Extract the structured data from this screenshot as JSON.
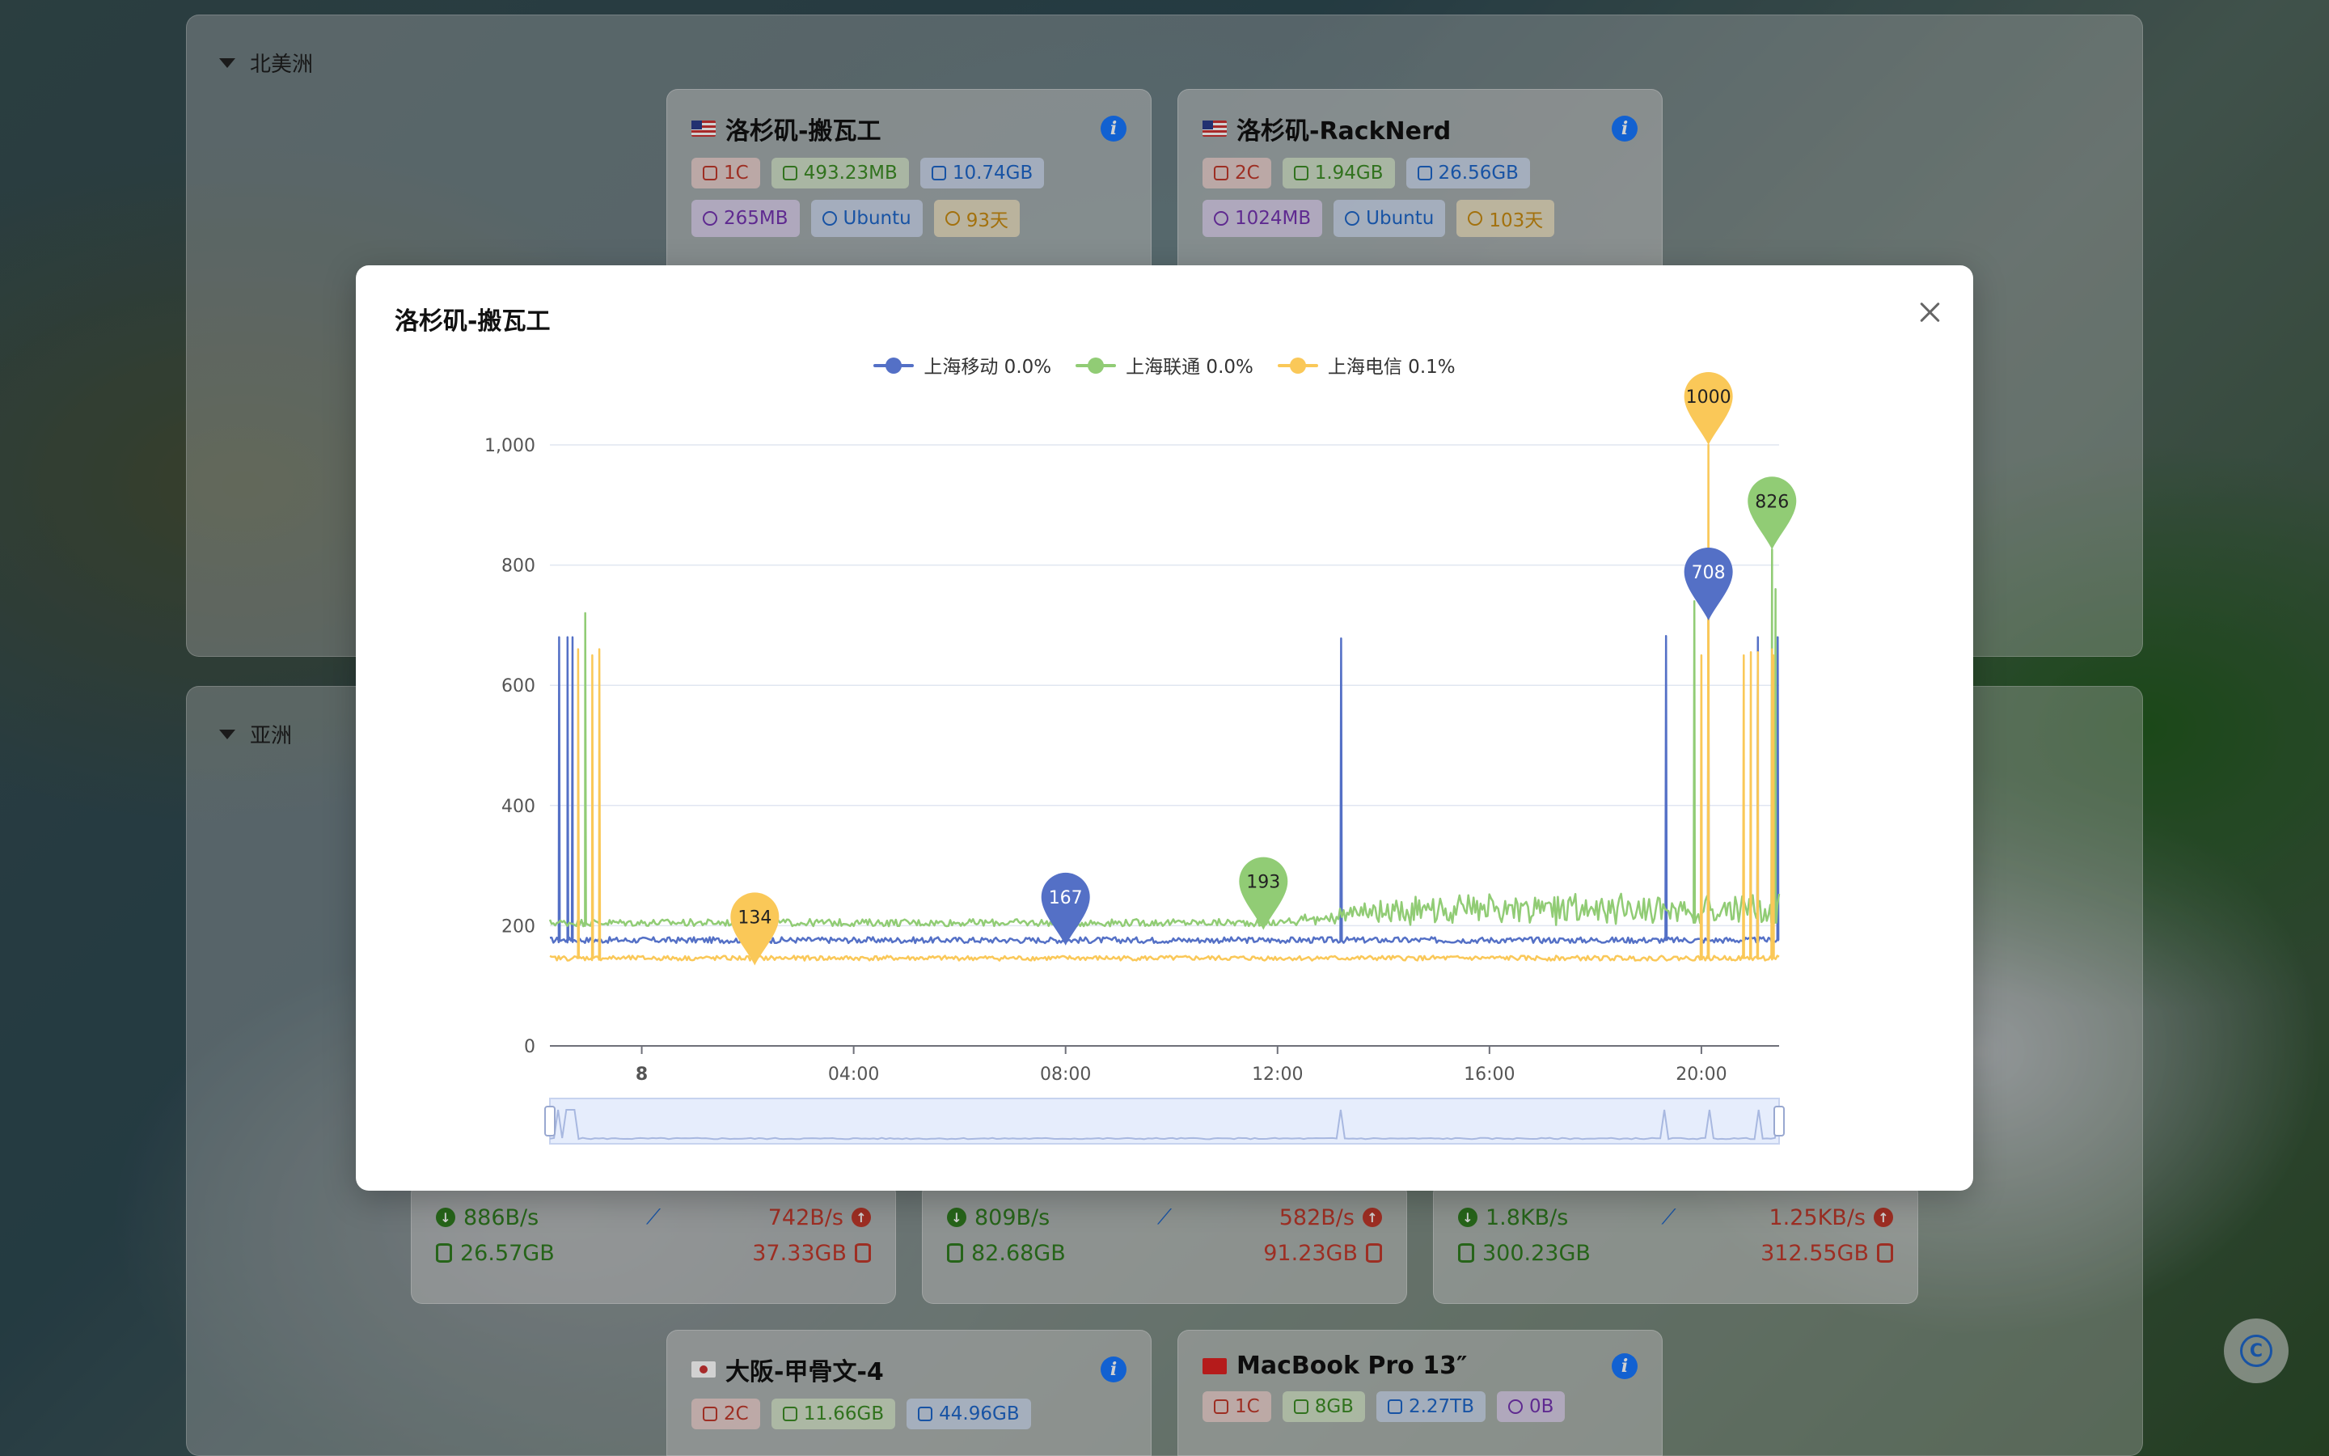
{
  "regions": [
    {
      "name": "北美洲"
    },
    {
      "name": "亚洲"
    }
  ],
  "cards": [
    {
      "title": "洛杉矶-搬瓦工",
      "flag": "us-flag-icon",
      "tags": [
        {
          "text": "1C",
          "color": "red",
          "icon": "cpu-icon"
        },
        {
          "text": "493.23MB",
          "color": "green",
          "icon": "memory-icon"
        },
        {
          "text": "10.74GB",
          "color": "blue",
          "icon": "disk-icon"
        },
        {
          "text": "265MB",
          "color": "purple",
          "icon": "swap-icon"
        },
        {
          "text": "Ubuntu",
          "color": "blue",
          "icon": "os-icon"
        },
        {
          "text": "93天",
          "color": "gold",
          "icon": "clock-icon"
        }
      ]
    },
    {
      "title": "洛杉矶-RackNerd",
      "flag": "us-flag-icon",
      "tags": [
        {
          "text": "2C",
          "color": "red",
          "icon": "cpu-icon"
        },
        {
          "text": "1.94GB",
          "color": "green",
          "icon": "memory-icon"
        },
        {
          "text": "26.56GB",
          "color": "blue",
          "icon": "disk-icon"
        },
        {
          "text": "1024MB",
          "color": "purple",
          "icon": "swap-icon"
        },
        {
          "text": "Ubuntu",
          "color": "blue",
          "icon": "os-icon"
        },
        {
          "text": "103天",
          "color": "gold",
          "icon": "clock-icon"
        }
      ]
    },
    {
      "title": "大阪-甲骨文-4",
      "flag": "jp-flag-icon",
      "tags": [
        {
          "text": "2C",
          "color": "red",
          "icon": "cpu-icon"
        },
        {
          "text": "11.66GB",
          "color": "green",
          "icon": "memory-icon"
        },
        {
          "text": "44.96GB",
          "color": "blue",
          "icon": "disk-icon"
        }
      ]
    },
    {
      "title": "MacBook Pro 13″",
      "flag": "cn-flag-icon",
      "tags": [
        {
          "text": "1C",
          "color": "red",
          "icon": "cpu-icon"
        },
        {
          "text": "8GB",
          "color": "green",
          "icon": "memory-icon"
        },
        {
          "text": "2.27TB",
          "color": "blue",
          "icon": "disk-icon"
        },
        {
          "text": "0B",
          "color": "purple",
          "icon": "swap-icon"
        }
      ]
    }
  ],
  "net_cards": [
    {
      "down_speed": "886B/s",
      "up_speed": "742B/s",
      "down_total": "26.57GB",
      "up_total": "37.33GB"
    },
    {
      "down_speed": "809B/s",
      "up_speed": "582B/s",
      "down_total": "82.68GB",
      "up_total": "91.23GB"
    },
    {
      "down_speed": "1.8KB/s",
      "up_speed": "1.25KB/s",
      "down_total": "300.23GB",
      "up_total": "312.55GB"
    }
  ],
  "modal": {
    "title": "洛杉矶-搬瓦工"
  },
  "legend": [
    {
      "label": "上海移动 0.0%",
      "color": "#5470c6"
    },
    {
      "label": "上海联通 0.0%",
      "color": "#91cc75"
    },
    {
      "label": "上海电信 0.1%",
      "color": "#fac858"
    }
  ],
  "chart_data": {
    "type": "line",
    "x_unit": "hour",
    "x_range": [
      6.2,
      23.6
    ],
    "ylim": [
      0,
      1000
    ],
    "y_ticks": [
      0,
      200,
      400,
      600,
      800,
      1000
    ],
    "y_tick_labels": [
      "0",
      "200",
      "400",
      "600",
      "800",
      "1,000"
    ],
    "x_ticks": [
      {
        "value": 7.5,
        "label": "8"
      },
      {
        "value": 10.5,
        "label": "04:00"
      },
      {
        "value": 13.5,
        "label": "08:00"
      },
      {
        "value": 16.5,
        "label": "12:00"
      },
      {
        "value": 19.5,
        "label": "16:00"
      },
      {
        "value": 22.5,
        "label": "20:00"
      }
    ],
    "grid": true,
    "legend_position": "top-center",
    "series": [
      {
        "name": "上海移动",
        "color": "#5470c6",
        "baseline": 176,
        "noise": 5,
        "spikes": [
          {
            "x": 6.33,
            "y": 680
          },
          {
            "x": 6.45,
            "y": 680
          },
          {
            "x": 6.52,
            "y": 680
          },
          {
            "x": 17.4,
            "y": 678
          },
          {
            "x": 22.0,
            "y": 682
          },
          {
            "x": 22.6,
            "y": 708
          },
          {
            "x": 23.3,
            "y": 680
          },
          {
            "x": 23.58,
            "y": 680
          }
        ],
        "markers": [
          {
            "x": 13.5,
            "y": 167,
            "label": "167"
          },
          {
            "x": 22.6,
            "y": 708,
            "label": "708"
          }
        ]
      },
      {
        "name": "上海联通",
        "color": "#91cc75",
        "baseline": 205,
        "noise": 6,
        "spikes": [
          {
            "x": 6.7,
            "y": 720
          },
          {
            "x": 22.4,
            "y": 740
          },
          {
            "x": 23.5,
            "y": 826
          },
          {
            "x": 23.55,
            "y": 760
          }
        ],
        "markers": [
          {
            "x": 16.3,
            "y": 193,
            "label": "193"
          },
          {
            "x": 23.5,
            "y": 826,
            "label": "826"
          }
        ]
      },
      {
        "name": "上海电信",
        "color": "#fac858",
        "baseline": 146,
        "noise": 4,
        "spikes": [
          {
            "x": 6.6,
            "y": 660
          },
          {
            "x": 6.8,
            "y": 650
          },
          {
            "x": 6.9,
            "y": 660
          },
          {
            "x": 22.5,
            "y": 650
          },
          {
            "x": 22.6,
            "y": 1000
          },
          {
            "x": 23.1,
            "y": 650
          },
          {
            "x": 23.2,
            "y": 655
          },
          {
            "x": 23.3,
            "y": 655
          },
          {
            "x": 23.5,
            "y": 660
          },
          {
            "x": 23.52,
            "y": 650
          }
        ],
        "markers": [
          {
            "x": 9.1,
            "y": 134,
            "label": "134"
          },
          {
            "x": 22.6,
            "y": 1000,
            "label": "1000"
          }
        ]
      }
    ]
  }
}
